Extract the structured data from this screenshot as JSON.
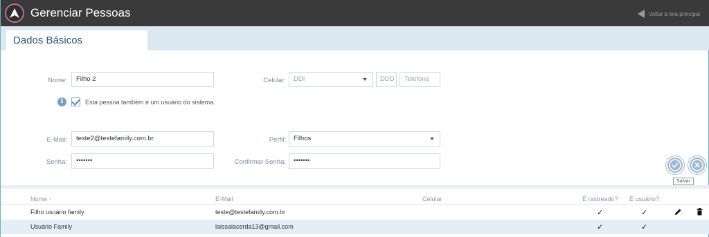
{
  "header": {
    "title": "Gerenciar Pessoas",
    "back_label": "Voltar à tela principal"
  },
  "tabs": [
    {
      "label": "Dados Básicos"
    }
  ],
  "form": {
    "nome": {
      "label": "Nome:",
      "value": "Filho 2"
    },
    "celular": {
      "label": "Celular:",
      "ddi_placeholder": "DDI",
      "ddd_placeholder": "DDD",
      "telefone_placeholder": "Telefone"
    },
    "usuario_checkbox": {
      "label": "Esta pessoa também é um usuário do sistema.",
      "checked": true
    },
    "email": {
      "label": "E-Mail:",
      "value": "teste2@testefamily.com.br"
    },
    "perfil": {
      "label": "Perfil:",
      "value": "Filhos"
    },
    "senha": {
      "label": "Senha:",
      "value": "•••••••"
    },
    "confirmar_senha": {
      "label": "Confirmar Senha:",
      "value": "•••••••"
    }
  },
  "actions": {
    "save_tooltip": "Salvar"
  },
  "table": {
    "columns": [
      "Nome ↑",
      "E-Mail",
      "Celular",
      "É rastreado?",
      "É usuário?"
    ],
    "rows": [
      {
        "nome": "Filho usuário family",
        "email": "teste@testefamily.com.br",
        "celular": "",
        "rastreado": "✓",
        "usuario": "✓"
      },
      {
        "nome": "Usuário Family",
        "email": "laissalacerda13@gmail.com",
        "celular": "",
        "rastreado": "✓",
        "usuario": "✓"
      }
    ]
  },
  "colors": {
    "header_bg": "#3a3a3a",
    "tabbar_bg": "#dbe7f1",
    "accent": "#2a5a7c",
    "row_alt": "#e4eef7"
  }
}
